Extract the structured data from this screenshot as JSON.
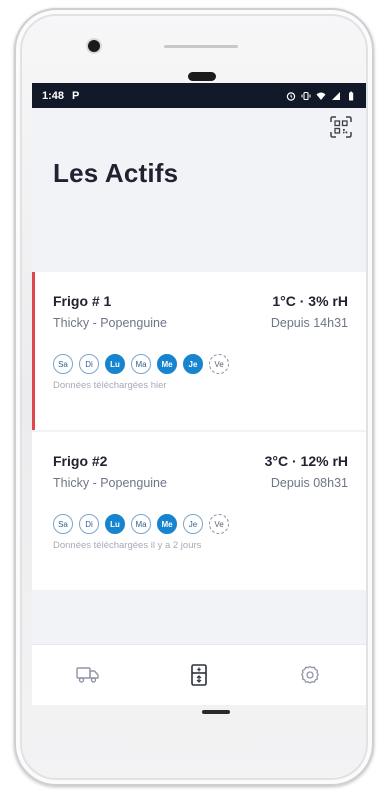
{
  "status_bar": {
    "time": "1:48",
    "app_glyph": "P"
  },
  "header": {
    "title": "Les Actifs",
    "qr_icon": "qr-scan-icon"
  },
  "assets": [
    {
      "name": "Frigo # 1",
      "reading": "1°C · 3% rH",
      "location": "Thicky - Popenguine",
      "since": "Depuis 14h31",
      "note": "Données téléchargées hier",
      "alert_color": "#e0464e",
      "days": [
        {
          "label": "Sa",
          "state": "off"
        },
        {
          "label": "Di",
          "state": "off"
        },
        {
          "label": "Lu",
          "state": "on"
        },
        {
          "label": "Ma",
          "state": "off"
        },
        {
          "label": "Me",
          "state": "on"
        },
        {
          "label": "Je",
          "state": "on"
        },
        {
          "label": "Ve",
          "state": "pending"
        }
      ]
    },
    {
      "name": "Frigo #2",
      "reading": "3°C · 12% rH",
      "location": "Thicky - Popenguine",
      "since": "Depuis 08h31",
      "note": "Données téléchargées il y a 2 jours",
      "days": [
        {
          "label": "Sa",
          "state": "off"
        },
        {
          "label": "Di",
          "state": "off"
        },
        {
          "label": "Lu",
          "state": "on"
        },
        {
          "label": "Ma",
          "state": "off"
        },
        {
          "label": "Me",
          "state": "on"
        },
        {
          "label": "Je",
          "state": "off"
        },
        {
          "label": "Ve",
          "state": "pending"
        }
      ]
    }
  ],
  "tabs": [
    {
      "icon": "truck-icon",
      "active": false
    },
    {
      "icon": "fridge-icon",
      "active": true
    },
    {
      "icon": "settings-gear-icon",
      "active": false
    }
  ],
  "colors": {
    "accent": "#1784cf",
    "alert": "#e0464e",
    "status_bar": "#111827",
    "background": "#f1f3f7"
  }
}
